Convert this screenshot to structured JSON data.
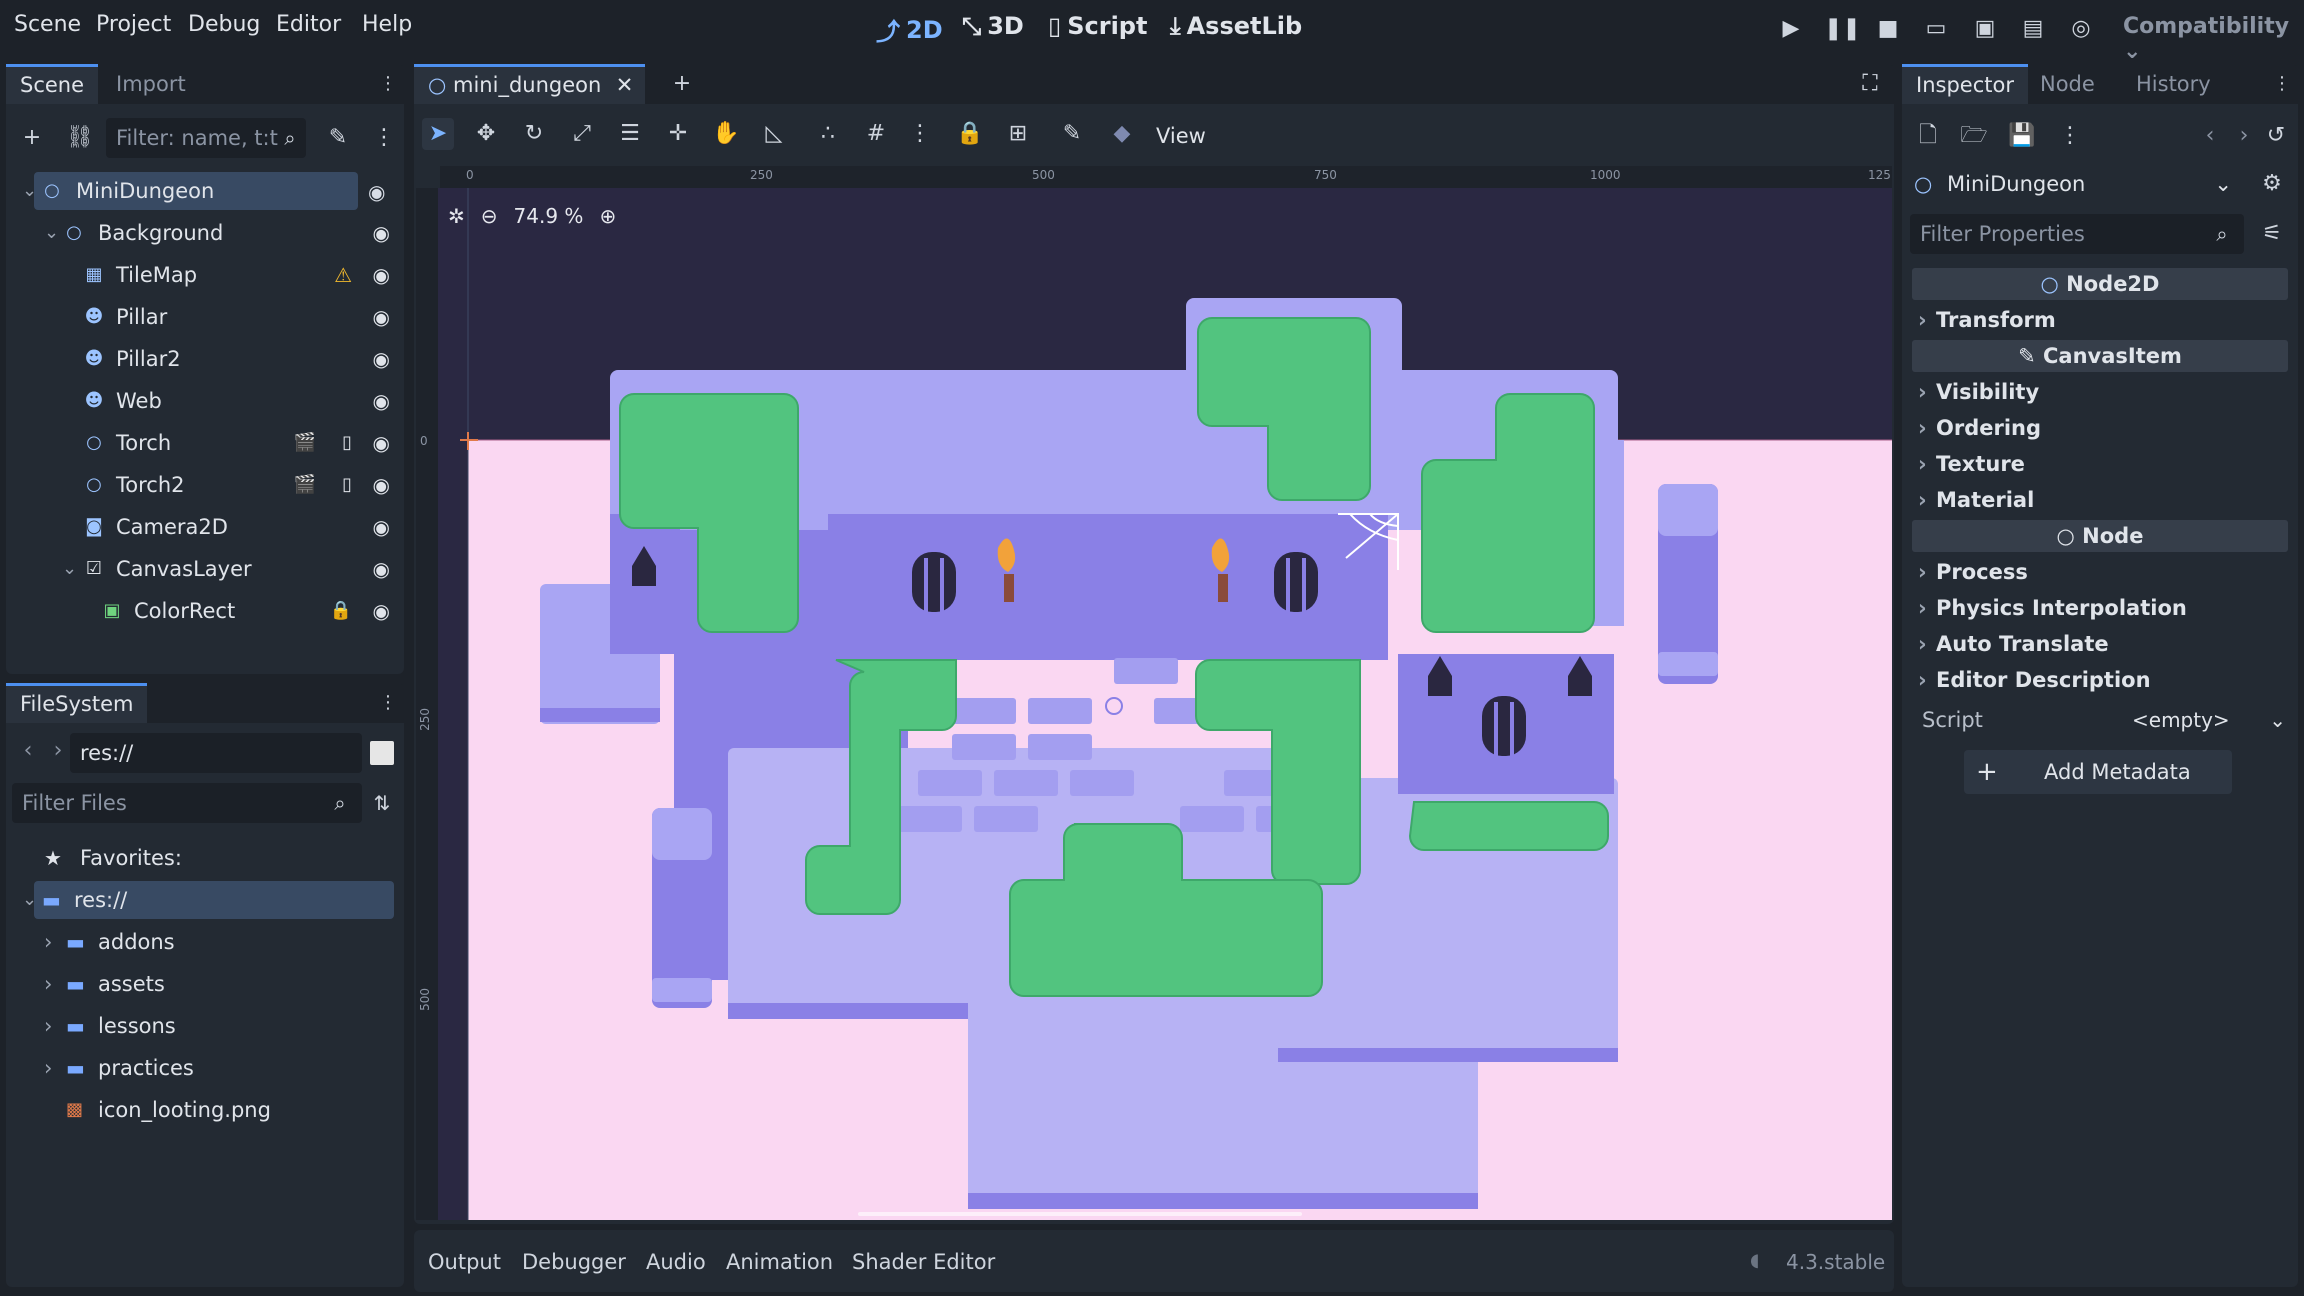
{
  "menu": {
    "items": [
      "Scene",
      "Project",
      "Debug",
      "Editor",
      "Help"
    ]
  },
  "workspaces": {
    "2d": "2D",
    "3d": "3D",
    "script": "Script",
    "assetlib": "AssetLib"
  },
  "renderer": "Compatibility",
  "scene_dock": {
    "tabs": [
      "Scene",
      "Import"
    ],
    "filter_placeholder": "Filter: name, t:t",
    "nodes": [
      {
        "label": "MiniDungeon",
        "icon": "node2d-icon"
      },
      {
        "label": "Background",
        "icon": "node2d-icon"
      },
      {
        "label": "TileMap",
        "icon": "tilemap-icon"
      },
      {
        "label": "Pillar",
        "icon": "sprite-icon"
      },
      {
        "label": "Pillar2",
        "icon": "sprite-icon"
      },
      {
        "label": "Web",
        "icon": "sprite-icon"
      },
      {
        "label": "Torch",
        "icon": "node2d-icon"
      },
      {
        "label": "Torch2",
        "icon": "node2d-icon"
      },
      {
        "label": "Camera2D",
        "icon": "camera-icon"
      },
      {
        "label": "CanvasLayer",
        "icon": "canvaslayer-icon"
      },
      {
        "label": "ColorRect",
        "icon": "colorrect-icon"
      }
    ]
  },
  "filesystem": {
    "tab": "FileSystem",
    "path": "res://",
    "filter_placeholder": "Filter Files",
    "favorites": "Favorites:",
    "root": "res://",
    "items": [
      "addons",
      "assets",
      "lessons",
      "practices",
      "icon_looting.png"
    ]
  },
  "editor": {
    "scene_tab": "mini_dungeon",
    "view_menu": "View",
    "zoom": "74.9 %",
    "ruler_labels": [
      "0",
      "250",
      "500",
      "750",
      "1000",
      "125"
    ],
    "vruler_labels": [
      "0",
      "250",
      "500"
    ]
  },
  "bottom_panel": {
    "tabs": [
      "Output",
      "Debugger",
      "Audio",
      "Animation",
      "Shader Editor"
    ],
    "version": "4.3.stable"
  },
  "inspector": {
    "tabs": [
      "Inspector",
      "Node",
      "History"
    ],
    "object": "MiniDungeon",
    "filter_placeholder": "Filter Properties",
    "header_node2d": "Node2D",
    "header_canvasitem": "CanvasItem",
    "header_node": "Node",
    "sections_node2d": [
      "Transform"
    ],
    "sections_canvasitem": [
      "Visibility",
      "Ordering",
      "Texture",
      "Material"
    ],
    "sections_node": [
      "Process",
      "Physics Interpolation",
      "Auto Translate",
      "Editor Description"
    ],
    "script_label": "Script",
    "script_value": "<empty>",
    "add_metadata": "Add Metadata"
  },
  "colors": {
    "accent": "#4d90f0",
    "canvas_bg": "#fad7f2",
    "wall_top": "#a9a5f3",
    "wall_face": "#8a80e6",
    "floor": "#b7b2f4",
    "bush": "#52c47f",
    "warning": "#f0b82e"
  }
}
